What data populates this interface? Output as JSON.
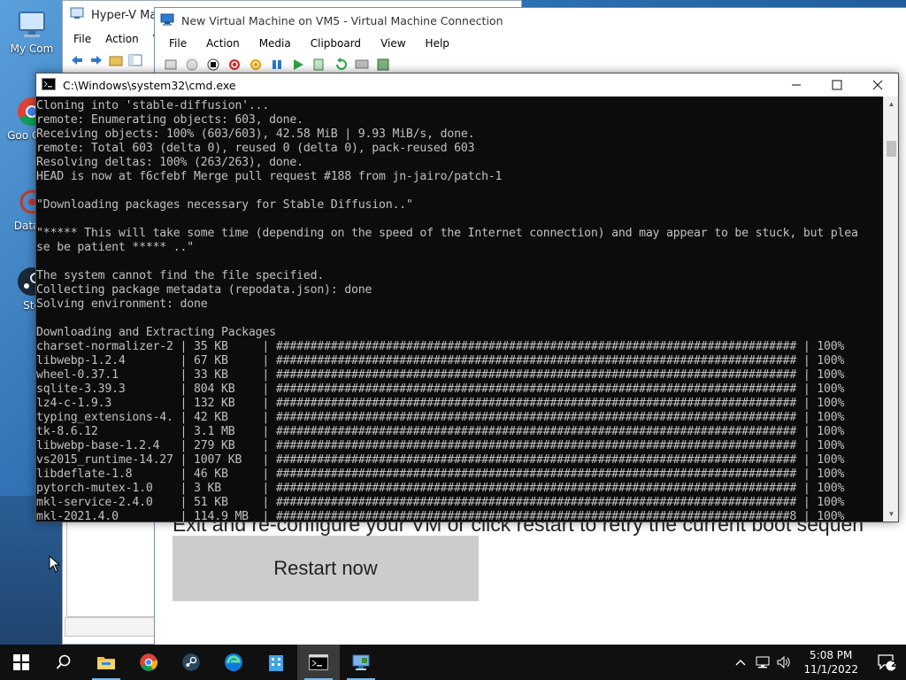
{
  "colors": {
    "console_bg": "#0c0c0c",
    "console_text": "#c0c0c0",
    "taskbar_bg": "#101010",
    "restart_button_bg": "#cccccc",
    "taskbar_running_indicator": "#76b9ed"
  },
  "desktop": {
    "icons": [
      {
        "label": "My Com",
        "icon": "computer-icon"
      },
      {
        "label": "Goo Chro",
        "icon": "chrome-icon"
      },
      {
        "label": "DataW",
        "icon": "datawarrior-icon"
      },
      {
        "label": "Ste",
        "icon": "steam-icon"
      }
    ]
  },
  "hyperv_manager": {
    "title": "Hyper-V Mana",
    "menu": [
      "File",
      "Action",
      "V"
    ]
  },
  "vm_connection": {
    "title": "New Virtual Machine on VM5 - Virtual Machine Connection",
    "menu": [
      "File",
      "Action",
      "Media",
      "Clipboard",
      "View",
      "Help"
    ],
    "screen": {
      "message_right_fragment": "c",
      "message": "Exit and re-configure your VM or click restart to retry the current boot sequen",
      "restart_button": "Restart now"
    }
  },
  "cmd": {
    "title": "C:\\Windows\\system32\\cmd.exe",
    "lines": [
      "Cloning into 'stable-diffusion'...",
      "remote: Enumerating objects: 603, done.",
      "Receiving objects: 100% (603/603), 42.58 MiB | 9.93 MiB/s, done.",
      "Resolving deltas: 100% (263/263), done.",
      "HEAD is now at f6cfebf Merge pull request #188 from jn-jairo/patch-1",
      "",
      "\"Downloading packages necessary for Stable Diffusion..\"",
      "",
      "\"***** This will take some time (depending on the speed of the Internet connection) and may appear to be stuck, but plea",
      "se be patient ***** ..\"",
      "",
      "The system cannot find the file specified.",
      "Collecting package metadata (repodata.json): done",
      "Solving environment: done",
      "",
      "Downloading and Extracting Packages",
      "charset-normalizer-2 | 35 KB     | ############################################################################ | 100%",
      "libwebp-1.2.4        | 67 KB     | ############################################################################ | 100%",
      "wheel-0.37.1         | 33 KB     | ############################################################################ | 100%",
      "sqlite-3.39.3        | 804 KB    | ############################################################################ | 100%",
      "lz4-c-1.9.3          | 132 KB    | ############################################################################ | 100%",
      "typing_extensions-4. | 42 KB     | ############################################################################ | 100%",
      "tk-8.6.12            | 3.1 MB    | ############################################################################ | 100%",
      "libwebp-base-1.2.4   | 279 KB    | ############################################################################ | 100%",
      "vs2015_runtime-14.27 | 1007 KB   | ############################################################################ | 100%",
      "libdeflate-1.8       | 46 KB     | ############################################################################ | 100%",
      "pytorch-mutex-1.0    | 3 KB      | ############################################################################ | 100%",
      "mkl-service-2.4.0    | 51 KB     | ############################################################################ | 100%",
      "mkl-2021.4.0         | 114.9 MB  | ###########################################################################8 | 100%"
    ],
    "remote_total_line": "remote: Total 603 (delta 0), reused 0 (delta 0), pack-reused 603"
  },
  "taskbar": {
    "apps": [
      {
        "name": "start-button",
        "icon": "windows-logo-icon"
      },
      {
        "name": "search-button",
        "icon": "search-icon"
      },
      {
        "name": "file-explorer",
        "icon": "folder-icon"
      },
      {
        "name": "chrome",
        "icon": "chrome-icon"
      },
      {
        "name": "steam",
        "icon": "steam-icon"
      },
      {
        "name": "edge",
        "icon": "edge-icon"
      },
      {
        "name": "app-store",
        "icon": "building-icon"
      },
      {
        "name": "cmd",
        "icon": "console-icon"
      },
      {
        "name": "hyper-v",
        "icon": "hyperv-icon"
      }
    ],
    "time": "5:08 PM",
    "date": "11/1/2022",
    "notification_count": "2"
  }
}
